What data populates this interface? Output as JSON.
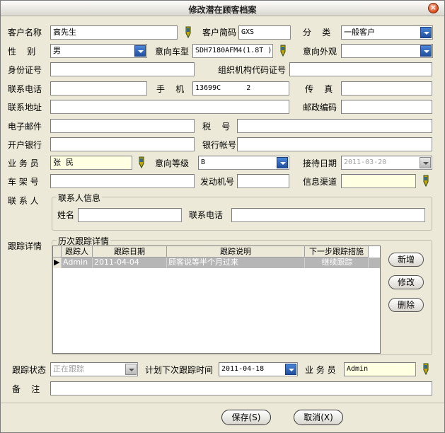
{
  "window": {
    "title": "修改潜在顾客档案",
    "close_glyph": "×"
  },
  "form": {
    "customer_name": {
      "label": "客户名称",
      "value": "高先生"
    },
    "short_code": {
      "label": "客户简码",
      "value": "GXS"
    },
    "category": {
      "label": "分    类",
      "value": "一般客户"
    },
    "gender": {
      "label": "性    别",
      "value": "男"
    },
    "intended_model": {
      "label": "意向车型",
      "value": "SDH7180AFM4(1.8T )"
    },
    "intended_exterior": {
      "label": "意向外观",
      "value": ""
    },
    "id_number": {
      "label": "身份证号",
      "value": ""
    },
    "org_code": {
      "label": "组织机构代码证号",
      "value": ""
    },
    "phone": {
      "label": "联系电话",
      "value": ""
    },
    "mobile": {
      "label": "手    机",
      "value": "13699C      2"
    },
    "fax": {
      "label": "传    真",
      "value": ""
    },
    "address": {
      "label": "联系地址",
      "value": ""
    },
    "postcode": {
      "label": "邮政编码",
      "value": ""
    },
    "email": {
      "label": "电子邮件",
      "value": ""
    },
    "tax_no": {
      "label": "税    号",
      "value": ""
    },
    "bank": {
      "label": "开户银行",
      "value": ""
    },
    "bank_account": {
      "label": "银行帐号",
      "value": ""
    },
    "salesperson": {
      "label": "业 务 员",
      "value": "张  民"
    },
    "intent_level": {
      "label": "意向等级",
      "value": "B"
    },
    "reception_date": {
      "label": "接待日期",
      "value": "2011-03-20"
    },
    "vin": {
      "label": "车 架 号",
      "value": ""
    },
    "engine_no": {
      "label": "发动机号",
      "value": ""
    },
    "info_channel": {
      "label": "信息渠道",
      "value": ""
    },
    "contact_person": {
      "label": "联 系 人"
    },
    "contact_info": {
      "title": "联系人信息",
      "name_label": "姓名",
      "name_value": "",
      "phone_label": "联系电话",
      "phone_value": ""
    },
    "tracking_label": "跟踪详情",
    "history": {
      "title": "历次跟踪详情",
      "columns": [
        "跟踪人",
        "跟踪日期",
        "跟踪说明",
        "下一步跟踪措施"
      ],
      "rows": [
        {
          "marker": "▶",
          "person": "Admin",
          "date": "2011-04-04",
          "note": "顾客说等半个月过来",
          "next": "继续跟踪"
        }
      ]
    },
    "buttons": {
      "add": "新增",
      "edit": "修改",
      "delete": "删除"
    },
    "tracking_status": {
      "label": "跟踪状态",
      "value": "正在跟踪"
    },
    "next_time": {
      "label": "计划下次跟踪时间",
      "value": "2011-04-18"
    },
    "salesperson2": {
      "label": "业 务 员",
      "value": "Admin"
    },
    "remarks": {
      "label": "备    注",
      "value": ""
    }
  },
  "footer": {
    "save": "保存(S)",
    "cancel": "取消(X)"
  },
  "colors": {
    "title_bg": "#ece9d8",
    "dropdown_blue": "#2f63b8",
    "selected_row": "#b6b6b6",
    "readonly_yellow": "#ffffe1"
  }
}
